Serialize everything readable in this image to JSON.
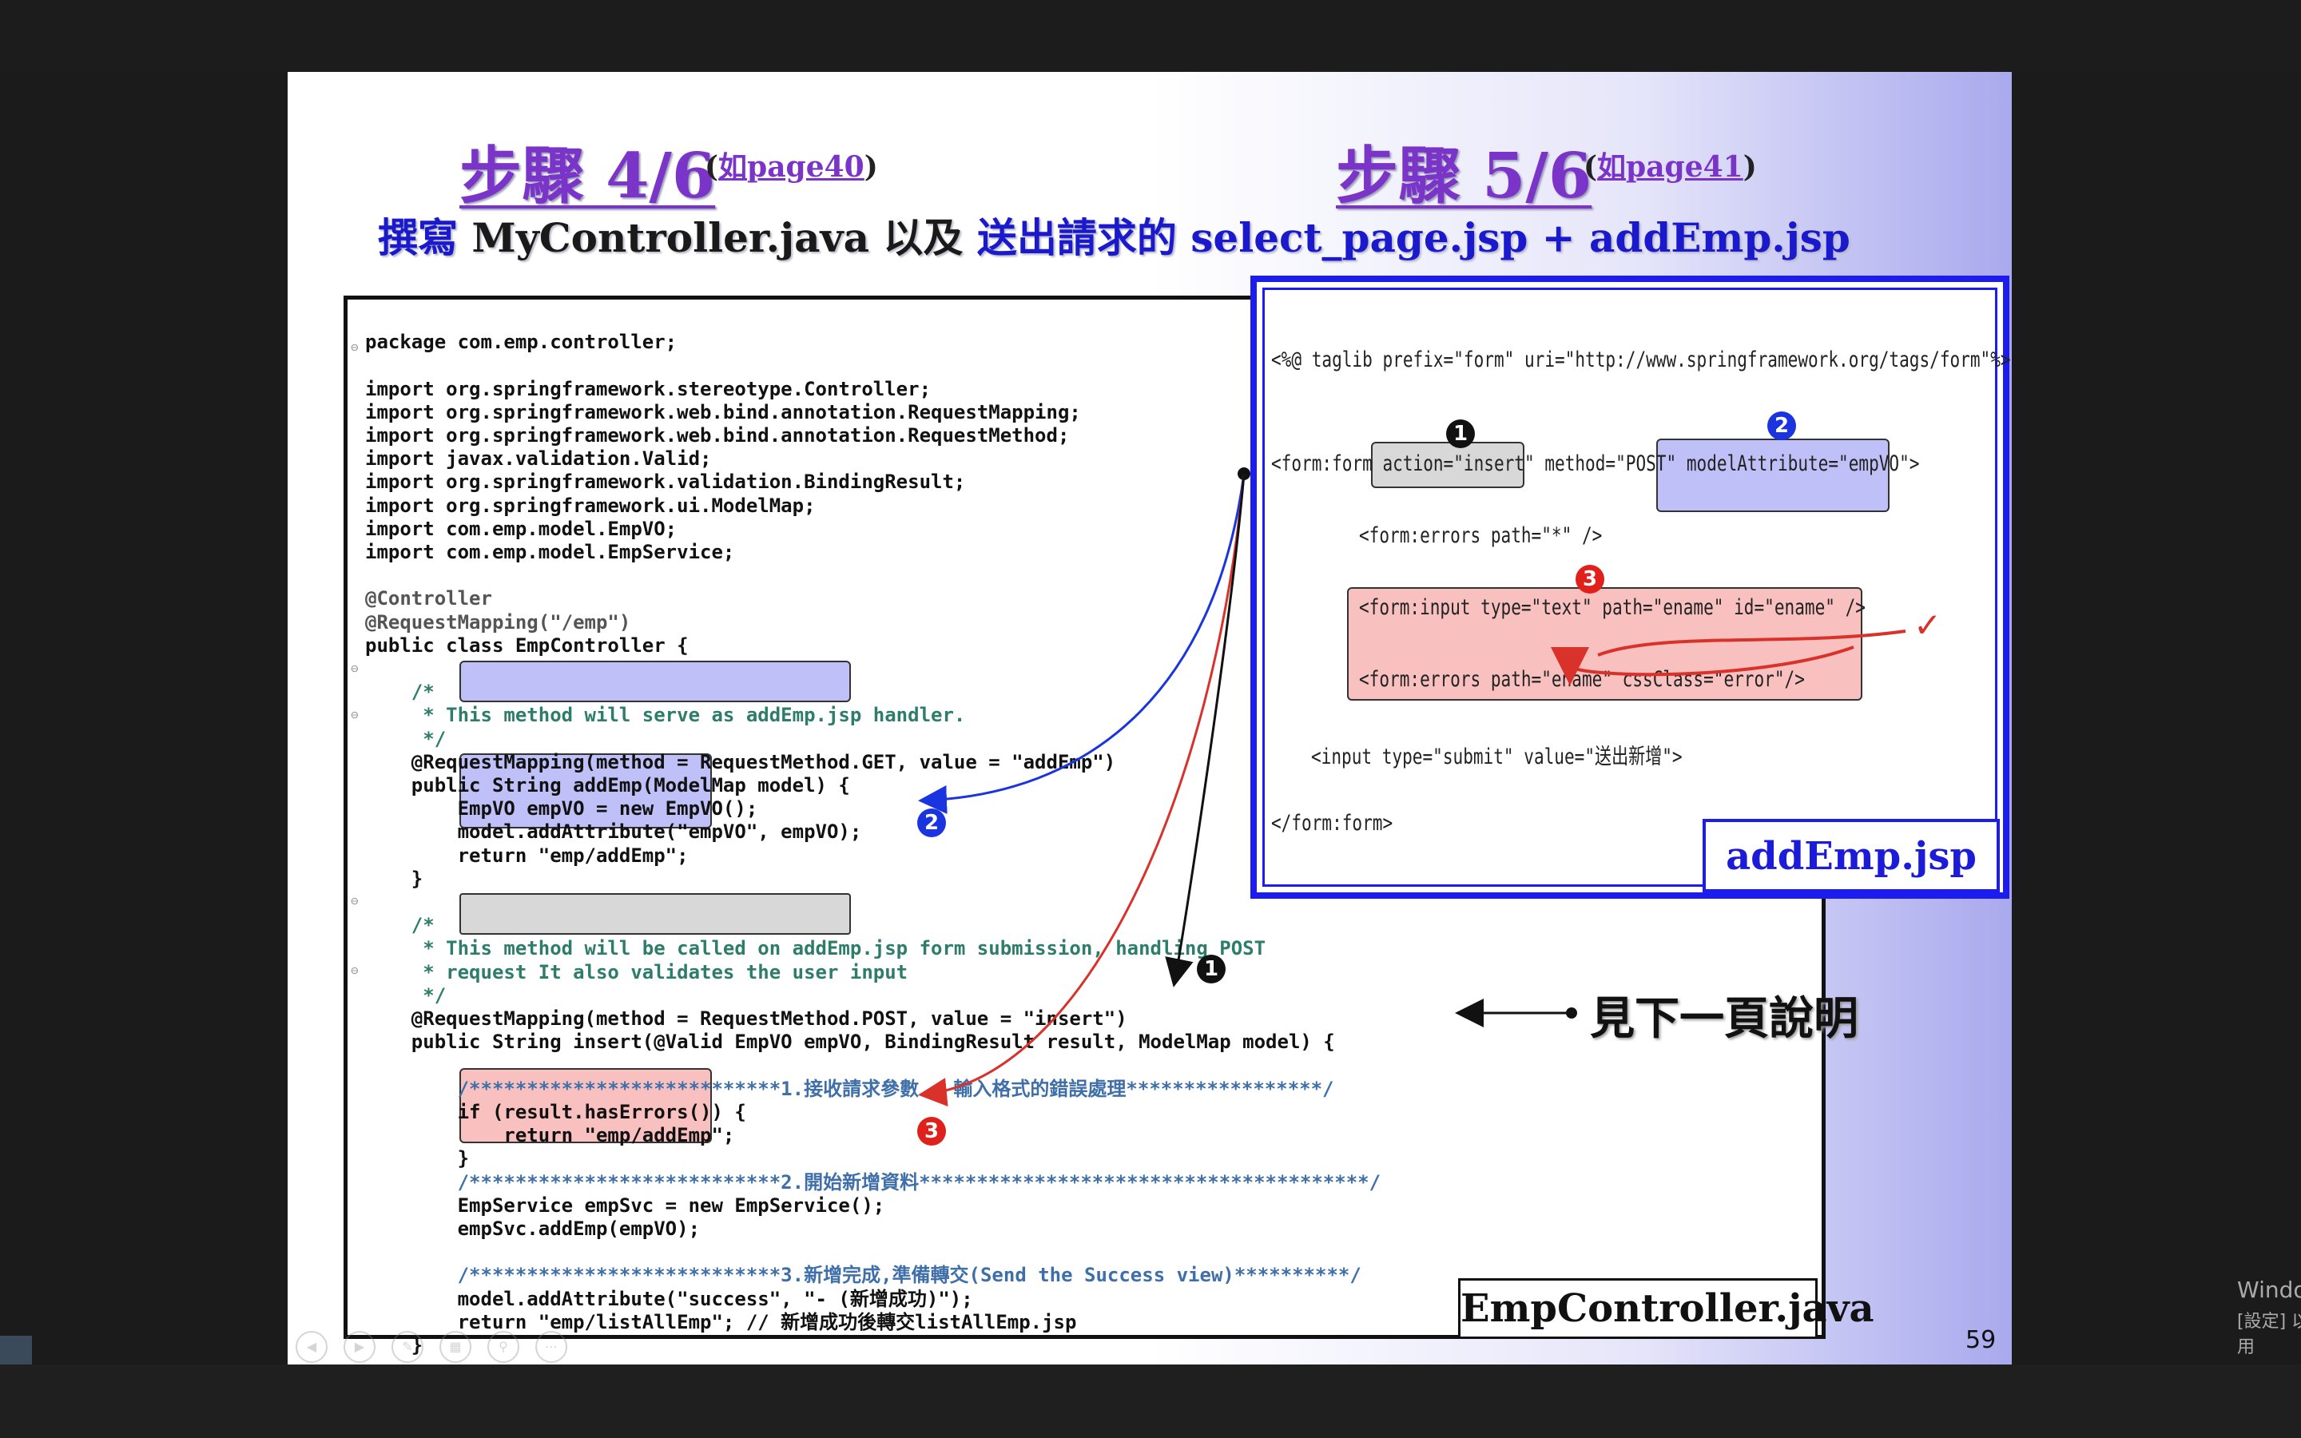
{
  "step4": {
    "title": "步驟 4/6",
    "ref_open": "(",
    "ref_link": "如page40",
    "ref_close": ")"
  },
  "step5": {
    "title": "步驟 5/6",
    "ref_open": "(",
    "ref_link": "如page41",
    "ref_close": ")"
  },
  "subtitle": {
    "part1": "撰寫",
    "part2": " MyController.java ",
    "part3": "以及 ",
    "part4": "送出請求的 select_page.jsp + addEmp.jsp"
  },
  "code_lines": [
    "package com.emp.controller;",
    "",
    "import org.springframework.stereotype.Controller;",
    "import org.springframework.web.bind.annotation.RequestMapping;",
    "import org.springframework.web.bind.annotation.RequestMethod;",
    "import javax.validation.Valid;",
    "import org.springframework.validation.BindingResult;",
    "import org.springframework.ui.ModelMap;",
    "import com.emp.model.EmpVO;",
    "import com.emp.model.EmpService;",
    "",
    "@Controller",
    "@RequestMapping(\"/emp\")",
    "public class EmpController {",
    "",
    "    /*",
    "     * This method will serve as addEmp.jsp handler.",
    "     */",
    "    @RequestMapping(method = RequestMethod.GET, value = \"addEmp\")",
    "    public String addEmp(ModelMap model) {",
    "        EmpVO empVO = new EmpVO();",
    "        model.addAttribute(\"empVO\", empVO);",
    "        return \"emp/addEmp\";",
    "    }",
    "",
    "    /*",
    "     * This method will be called on addEmp.jsp form submission, handling POST",
    "     * request It also validates the user input",
    "     */",
    "    @RequestMapping(method = RequestMethod.POST, value = \"insert\")",
    "    public String insert(@Valid EmpVO empVO, BindingResult result, ModelMap model) {",
    "",
    "        /***************************1.接收請求參數 - 輸入格式的錯誤處理*****************/",
    "        if (result.hasErrors()) {",
    "            return \"emp/addEmp\";",
    "        }",
    "        /***************************2.開始新增資料***************************************/",
    "        EmpService empSvc = new EmpService();",
    "        empSvc.addEmp(empVO);",
    "",
    "        /***************************3.新增完成,準備轉交(Send the Success view)**********/",
    "        model.addAttribute(\"success\", \"- (新增成功)\");",
    "        return \"emp/listAllEmp\"; // 新增成功後轉交listAllEmp.jsp",
    "    }"
  ],
  "jsp_lines": [
    "<%@ taglib prefix=\"form\" uri=\"http://www.springframework.org/tags/form\"%>",
    "<form:form action=\"insert\" method=\"POST\" modelAttribute=\"empVO\">",
    "<form:errors path=\"*\" />",
    "<form:input type=\"text\" path=\"ename\" id=\"ename\" />",
    "<form:errors path=\"ename\" cssClass=\"error\"/>",
    "<input type=\"submit\" value=\"送出新增\">",
    "</form:form>"
  ],
  "badges": {
    "one": "1",
    "two": "2",
    "three": "3"
  },
  "labels": {
    "controller_file": "EmpController.java",
    "jsp_file": "addEmp.jsp",
    "see_next": "見下一頁說明",
    "check_mark": "✓"
  },
  "page_number": "59",
  "watermark": {
    "line1": "Windows",
    "line2": "[設定] 以啟用 Windows。"
  },
  "colors": {
    "accent_purple": "#7a35c8",
    "link_blue": "#1a1acc",
    "box_blue": "#1c1cf0",
    "badge_red": "#e0201a",
    "badge_blue": "#1a34e0",
    "arrow_red": "#d8322a"
  }
}
